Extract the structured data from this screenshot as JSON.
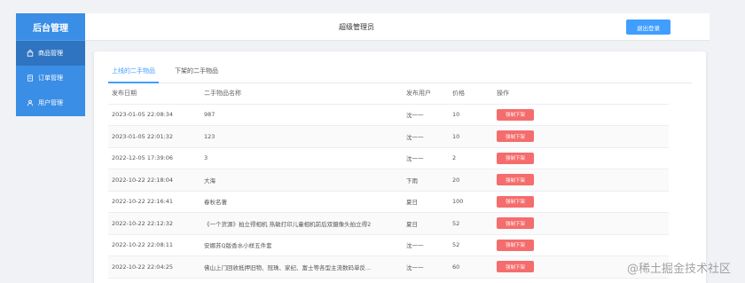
{
  "sidebar": {
    "title": "后台管理",
    "items": [
      {
        "label": "商品管理",
        "icon": "bag-icon"
      },
      {
        "label": "订单管理",
        "icon": "document-icon"
      },
      {
        "label": "用户管理",
        "icon": "user-icon"
      }
    ]
  },
  "header": {
    "title": "超级管理员",
    "logout_label": "退出登录"
  },
  "tabs": [
    {
      "label": "上线的二手物品"
    },
    {
      "label": "下架的二手物品"
    }
  ],
  "table": {
    "headers": [
      "发布日期",
      "二手物品名称",
      "发布用户",
      "价格",
      "操作"
    ],
    "action_label": "强制下架",
    "rows": [
      {
        "date": "2023-01-05 22:08:34",
        "name": "987",
        "user": "沈一一",
        "price": "10"
      },
      {
        "date": "2023-01-05 22:01:32",
        "name": "123",
        "user": "沈一一",
        "price": "10"
      },
      {
        "date": "2022-12-05 17:39:06",
        "name": "3",
        "user": "沈一一",
        "price": "2"
      },
      {
        "date": "2022-10-22 22:18:04",
        "name": "大海",
        "user": "下雨",
        "price": "20"
      },
      {
        "date": "2022-10-22 22:16:41",
        "name": "春秋名著",
        "user": "夏日",
        "price": "100"
      },
      {
        "date": "2022-10-22 22:12:32",
        "name": "《一个货源》拍立得相机 热敏打印儿童相机前后双摄像头拍立得2",
        "user": "夏日",
        "price": "52"
      },
      {
        "date": "2022-10-22 22:08:11",
        "name": "安娜苏Q版香水小样五件套",
        "user": "沈一一",
        "price": "52"
      },
      {
        "date": "2022-10-22 22:04:25",
        "name": "佛山上门回收抵押旧物、冠珠、家纪、富士等各型主流数码单反...",
        "user": "沈一一",
        "price": "60"
      }
    ]
  },
  "watermark": "@稀土掘金技术社区",
  "colors": {
    "sidebar_bg": "#3a8ee6",
    "primary": "#409eff",
    "danger": "#f56c6c"
  }
}
